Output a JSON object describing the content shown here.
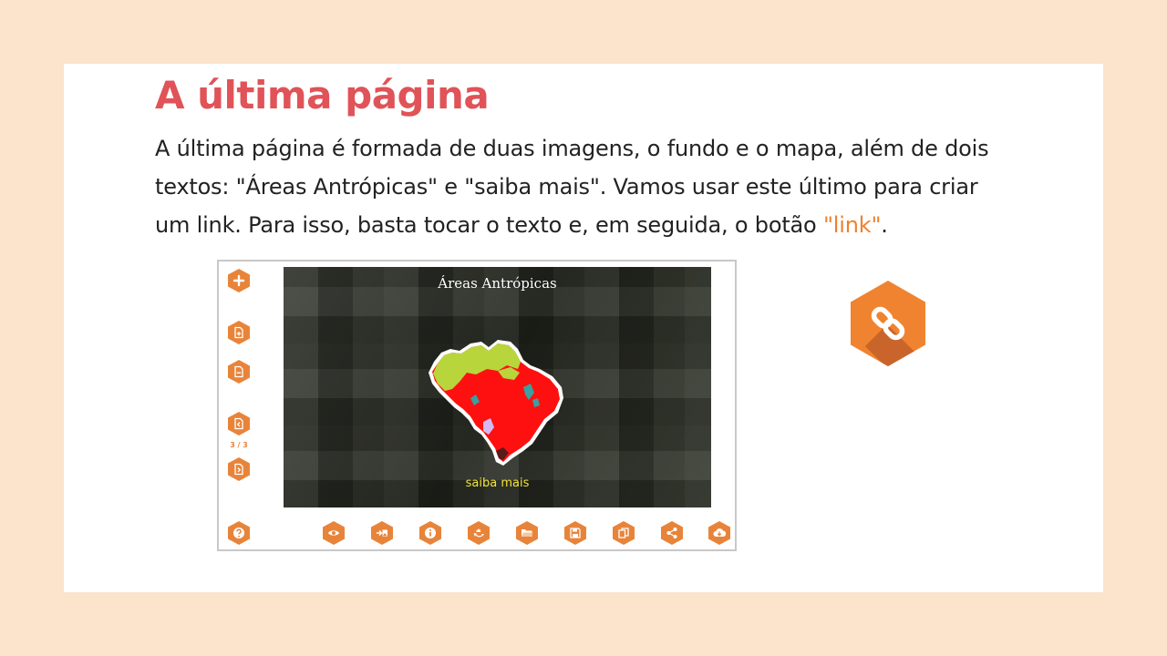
{
  "slide": {
    "title": "A última página",
    "paragraph_main": "A última página é formada de duas imagens, o fundo e o mapa, além de dois textos: \"Áreas Antrópicas\" e \"saiba mais\". Vamos usar este último para criar um link. Para isso, basta tocar o texto e, em seguida, o botão ",
    "paragraph_link": "\"link\"",
    "paragraph_end": "."
  },
  "app": {
    "page_counter": "3 / 3",
    "canvas_title": "Áreas Antrópicas",
    "canvas_link_text": "saiba mais",
    "left_toolbar": [
      "add-icon",
      "add-page-icon",
      "remove-page-icon",
      "prev-page-icon",
      "next-page-icon",
      "help-icon"
    ],
    "bottom_toolbar": [
      "eye-icon",
      "import-image-icon",
      "info-icon",
      "recycle-icon",
      "folder-icon",
      "save-icon",
      "copy-icon",
      "share-icon",
      "download-icon"
    ]
  },
  "colors": {
    "background": "#fbe3cc",
    "title": "#e05358",
    "accent": "#f0812e",
    "button": "#e8843a",
    "map_green": "#b5d63a",
    "map_red": "#ff0000",
    "map_teal": "#3a9a9a"
  }
}
